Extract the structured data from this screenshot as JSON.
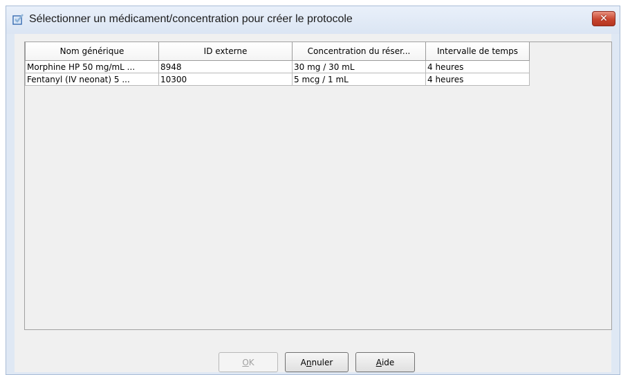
{
  "dialog": {
    "title": "Sélectionner un médicament/concentration pour créer le protocole",
    "close_label": "✕"
  },
  "table": {
    "columns": [
      "Nom générique",
      "ID externe",
      "Concentration du réser...",
      "Intervalle de temps"
    ],
    "rows": [
      [
        "Morphine HP  50 mg/mL ...",
        "8948",
        "30 mg / 30 mL",
        "4 heures"
      ],
      [
        "Fentanyl (IV neonat) 5 ...",
        "10300",
        "5 mcg / 1 mL",
        "4 heures"
      ]
    ]
  },
  "buttons": {
    "ok": {
      "mnemonic": "O",
      "rest": "K"
    },
    "cancel": {
      "pre": "A",
      "mnemonic": "n",
      "rest": "nuler"
    },
    "help": {
      "mnemonic": "A",
      "rest": "ide"
    }
  },
  "colors": {
    "dialog_bg": "#dfe8f4",
    "content_bg": "#f0f0f0",
    "close_red": "#c8452f"
  },
  "icons": {
    "title": "checkbox-icon",
    "close": "close-icon"
  }
}
